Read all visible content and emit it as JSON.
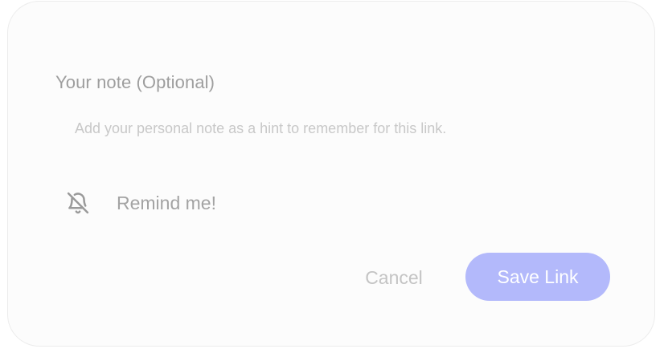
{
  "note": {
    "label": "Your note (Optional)",
    "placeholder": "Add your personal note as a hint to remember for this link.",
    "value": ""
  },
  "reminder": {
    "icon": "bell-off-icon",
    "label": "Remind me!"
  },
  "actions": {
    "cancel_label": "Cancel",
    "save_label": "Save Link"
  },
  "colors": {
    "accent": "#b3b9fb",
    "muted_text": "#9e9e9e",
    "placeholder_text": "#c8c8c8"
  }
}
